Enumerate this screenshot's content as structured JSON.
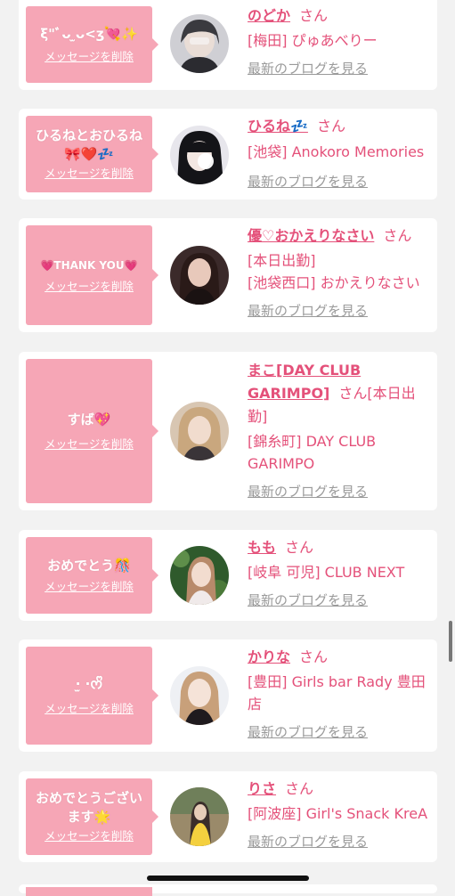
{
  "colors": {
    "accent": "#e4517a",
    "bubble": "#f6a6b6",
    "muted": "#9a9a9a",
    "background": "#f2f2f2"
  },
  "common": {
    "delete_label": "メッセージを削除",
    "blog_label": "最新のブログを見る",
    "honorific": "さん"
  },
  "entries": [
    {
      "message": "ξ\"ﾞᴗ ̫ᴗ<ʒ💘✨",
      "name": "のどか",
      "shop": "[梅田] ぴゅあべりー"
    },
    {
      "message": "ひるねとおひるね🎀❤️💤",
      "name": "ひるね💤",
      "shop": "[池袋] Anokoro Memories"
    },
    {
      "message": "💗THANK YOU💗",
      "name": "優♡おかえりなさい",
      "shop1": "[本日出勤]",
      "shop2": "[池袋西口] おかえりなさい"
    },
    {
      "message": "すば💖",
      "name": "まこ[DAY CLUB GARIMPO]",
      "name_suffix": "[本日出勤]",
      "shop": "[錦糸町] DAY CLUB GARIMPO"
    },
    {
      "message": "おめでとう🎊",
      "name": "もも",
      "shop": "[岐阜 可児] CLUB NEXT"
    },
    {
      "message": "·̫ ·ᰔᩚ",
      "name": "かりな",
      "shop": "[豊田] Girls bar Rady 豊田店"
    },
    {
      "message": "おめでとうございます🌟",
      "name": "りさ",
      "shop": "[阿波座] Girl's Snack KreA"
    }
  ]
}
